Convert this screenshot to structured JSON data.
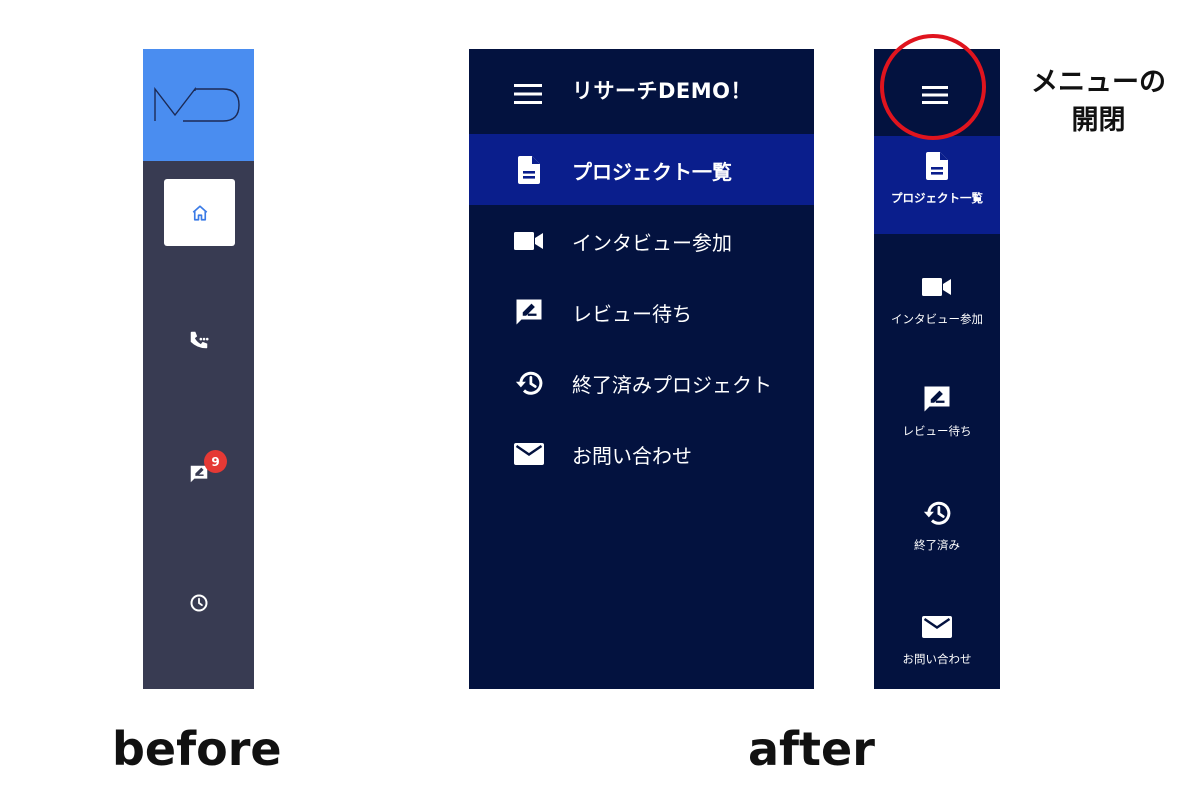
{
  "captions": {
    "before": "before",
    "after": "after"
  },
  "before_sidebar": {
    "logo_text": "MD",
    "items": [
      {
        "icon": "home-icon",
        "selected": true
      },
      {
        "icon": "phone-dots-icon"
      },
      {
        "icon": "review-icon",
        "badge": "9"
      },
      {
        "icon": "clock-icon"
      }
    ]
  },
  "expanded_menu": {
    "title": "リサーチDEMO！",
    "items": [
      {
        "label": "プロジェクト一覧",
        "icon": "document-icon",
        "active": true
      },
      {
        "label": "インタビュー参加",
        "icon": "video-camera-icon"
      },
      {
        "label": "レビュー待ち",
        "icon": "review-icon"
      },
      {
        "label": "終了済みプロジェクト",
        "icon": "history-icon"
      },
      {
        "label": "お問い合わせ",
        "icon": "mail-icon"
      }
    ]
  },
  "collapsed_menu": {
    "items": [
      {
        "label": "プロジェクト一覧",
        "icon": "document-icon",
        "active": true
      },
      {
        "label": "インタビュー参加",
        "icon": "video-camera-icon"
      },
      {
        "label": "レビュー待ち",
        "icon": "review-icon"
      },
      {
        "label": "終了済み",
        "icon": "history-icon"
      },
      {
        "label": "お問い合わせ",
        "icon": "mail-icon"
      }
    ]
  },
  "annotation": {
    "line1": "メニューの",
    "line2": "開閉"
  },
  "colors": {
    "before_bg": "#383b52",
    "before_logo_bg": "#4a8df0",
    "after_bg": "#03123f",
    "active_item_bg": "#0a1e8c",
    "badge": "#e53935",
    "highlight": "#e0141e"
  }
}
